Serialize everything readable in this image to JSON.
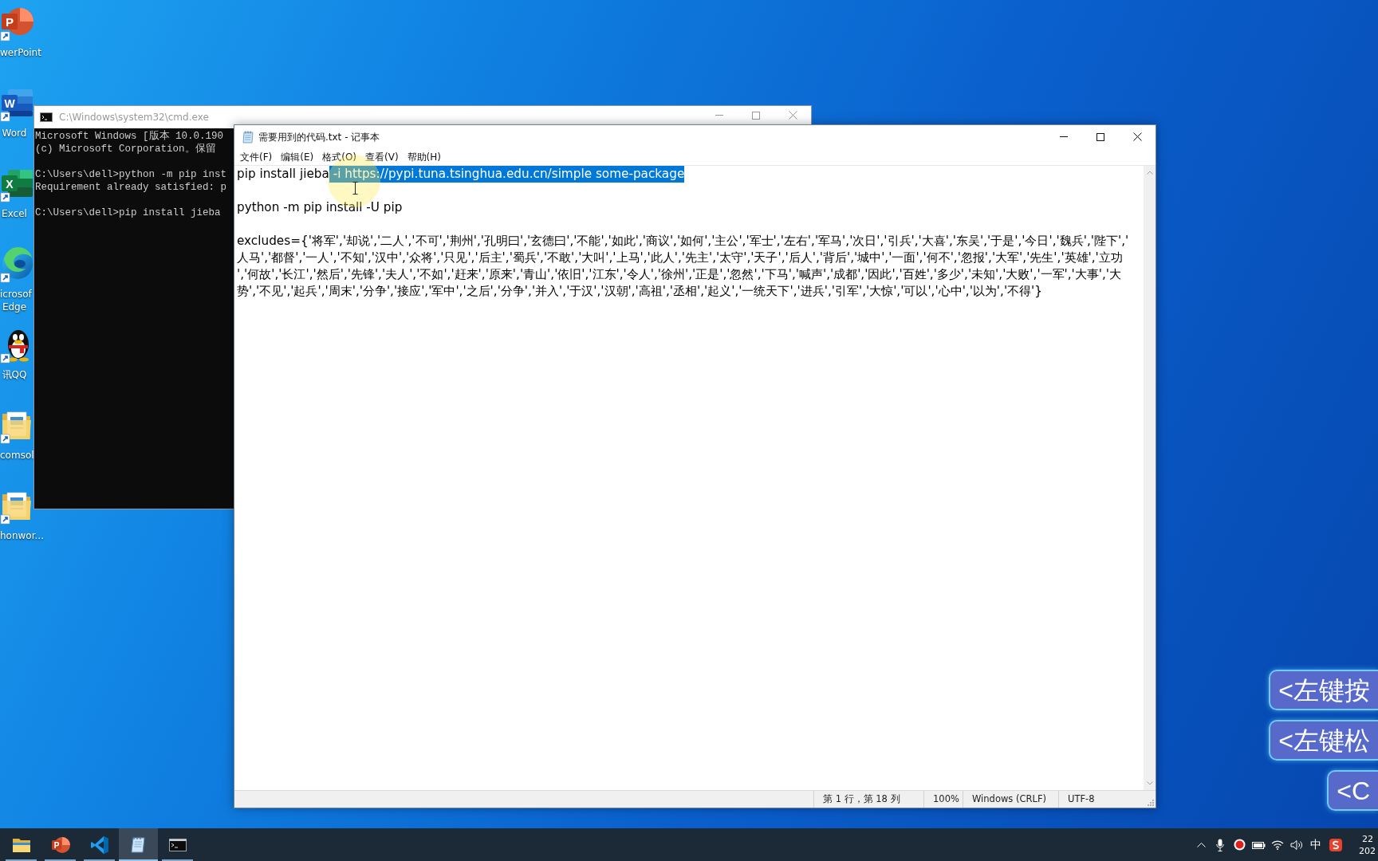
{
  "desktop": {
    "icons": [
      {
        "kind": "powerpoint",
        "letter": "P",
        "lines": [
          "werPoint"
        ]
      },
      {
        "kind": "word",
        "letter": "W",
        "lines": [
          "Word"
        ]
      },
      {
        "kind": "excel",
        "letter": "X",
        "lines": [
          "Excel"
        ]
      },
      {
        "kind": "edge",
        "lines": [
          "icrosof",
          "Edge"
        ]
      },
      {
        "kind": "qq",
        "lines": [
          "讯QQ"
        ]
      },
      {
        "kind": "folder",
        "lines": [
          "comsol"
        ]
      },
      {
        "kind": "folder",
        "lines": [
          "honwor..."
        ]
      }
    ]
  },
  "cmd_window": {
    "title": "C:\\Windows\\system32\\cmd.exe",
    "blocks": [
      [
        "Microsoft Windows [版本 10.0.190",
        "(c) Microsoft Corporation。保留"
      ],
      [
        "C:\\Users\\dell>python -m pip inst",
        "Requirement already satisfied: p"
      ],
      [
        "C:\\Users\\dell>pip install jieba"
      ]
    ]
  },
  "notepad": {
    "title": "需要用到的代码.txt - 记事本",
    "menu": [
      "文件(F)",
      "编辑(E)",
      "格式(O)",
      "查看(V)",
      "帮助(H)"
    ],
    "paragraphs": [
      {
        "rows": [
          {
            "segments": [
              {
                "text": "pip install jieba",
                "selected": false
              },
              {
                "text": " -i https://pypi.tuna.tsinghua.edu.cn/simple some-package",
                "selected": true
              }
            ]
          }
        ]
      },
      {
        "rows": [
          {
            "segments": [
              {
                "text": "python -m pip install -U pip",
                "selected": false
              }
            ]
          }
        ]
      },
      {
        "rows": [
          {
            "segments": [
              {
                "text": "excludes={'将军','却说','二人','不可','荆州','孔明曰','玄德曰','不能','如此','商议','如何','主公','军士','左右','军马','次日','引兵','大喜','东吴','于是','今日','魏兵','陛下','",
                "selected": false
              }
            ]
          },
          {
            "segments": [
              {
                "text": "人马','都督','一人','不知','汉中','众将','只见','后主','蜀兵','不敢','大叫','上马','此人','先主','太守','天子','后人','背后','城中','一面','何不','忽报','大军','先生','英雄','立功",
                "selected": false
              }
            ]
          },
          {
            "segments": [
              {
                "text": "','何故','长江','然后','先锋','夫人','不如','赶来','原来','青山','依旧','江东','令人','徐州','正是','忽然','下马','喊声','成都','因此','百姓','多少','未知','大败','一军','大事','大",
                "selected": false
              }
            ]
          },
          {
            "segments": [
              {
                "text": "势','不见','起兵','周末','分争','接应','军中','之后','分争','并入','于汉','汉朝','高祖','丞相','起义','一统天下','进兵','引军','大惊','可以','心中','以为','不得'}",
                "selected": false
              }
            ]
          }
        ]
      }
    ],
    "status_bar": [
      "第 1 行，第 18 列",
      "100%",
      "Windows (CRLF)",
      "UTF-8"
    ]
  },
  "key_overlays": [
    "<左键按",
    "<左键松",
    "<C"
  ],
  "taskbar": {
    "apps": [
      {
        "kind": "explorer",
        "running": true,
        "selected": false
      },
      {
        "kind": "powerpoint",
        "letter": "P",
        "running": true,
        "selected": false
      },
      {
        "kind": "vscode",
        "running": true,
        "selected": false
      },
      {
        "kind": "notepad",
        "running": true,
        "selected": true
      },
      {
        "kind": "cmd",
        "running": true,
        "selected": false
      }
    ],
    "tray": {
      "ime": "中",
      "clock_time": "22",
      "clock_date": "202"
    }
  }
}
